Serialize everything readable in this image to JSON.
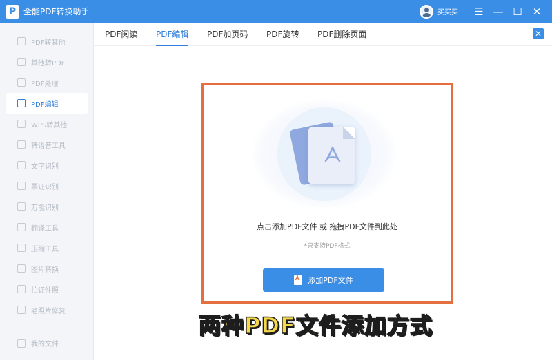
{
  "app": {
    "logo_letter": "P",
    "title": "全能PDF转换助手",
    "username": "买买买",
    "accent": "#3a8ee6"
  },
  "window_controls": {
    "menu": "☰",
    "minimize": "—",
    "maximize": "☐",
    "close": "✕"
  },
  "sidebar": {
    "items": [
      {
        "label": "PDF转其他",
        "icon": "pdf-convert-icon"
      },
      {
        "label": "其他转PDF",
        "icon": "to-pdf-icon"
      },
      {
        "label": "PDF处理",
        "icon": "pdf-process-icon"
      },
      {
        "label": "PDF编辑",
        "icon": "pdf-edit-icon",
        "active": true
      },
      {
        "label": "WPS转其他",
        "icon": "wps-icon"
      },
      {
        "label": "转语音工具",
        "icon": "voice-icon"
      },
      {
        "label": "文字识别",
        "icon": "ocr-icon"
      },
      {
        "label": "票证识别",
        "icon": "ticket-icon"
      },
      {
        "label": "万能识别",
        "icon": "scan-icon"
      },
      {
        "label": "翻译工具",
        "icon": "translate-icon"
      },
      {
        "label": "压缩工具",
        "icon": "compress-icon"
      },
      {
        "label": "图片转换",
        "icon": "image-icon"
      },
      {
        "label": "拍证件照",
        "icon": "id-photo-icon"
      },
      {
        "label": "老照片修复",
        "icon": "photo-repair-icon"
      }
    ],
    "my_files": "我的文件"
  },
  "tabs": [
    {
      "label": "PDF阅读"
    },
    {
      "label": "PDF编辑",
      "active": true
    },
    {
      "label": "PDF加页码"
    },
    {
      "label": "PDF旋转"
    },
    {
      "label": "PDF删除页面"
    }
  ],
  "close_tab": "✕",
  "dropzone": {
    "main_text": "点击添加PDF文件 或 拖拽PDF文件到此处",
    "sub_text": "*只支持PDF格式",
    "button_label": "添加PDF文件",
    "border_color": "#e4703f"
  },
  "caption": "两种PDF文件添加方式"
}
